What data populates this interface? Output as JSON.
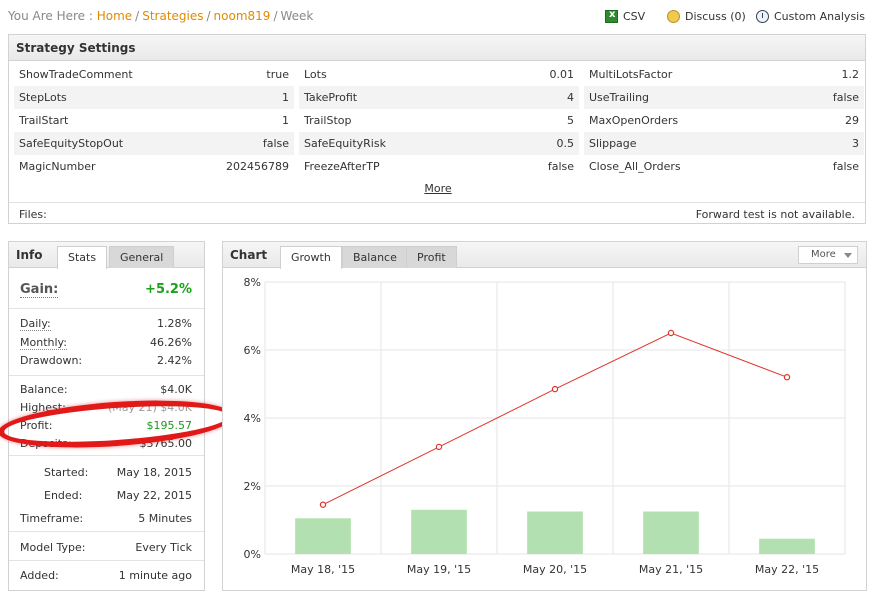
{
  "breadcrumb": {
    "prefix": "You Are Here :",
    "links": [
      "Home",
      "Strategies",
      "noom819"
    ],
    "current": "Week"
  },
  "actions": {
    "csv": "CSV",
    "discuss": "Discuss (0)",
    "custom_analysis": "Custom Analysis",
    "icons": [
      "excel-icon",
      "discuss-icon",
      "analysis-icon"
    ]
  },
  "settings": {
    "title": "Strategy Settings",
    "rows": [
      [
        [
          "ShowTradeComment",
          "true"
        ],
        [
          "Lots",
          "0.01"
        ],
        [
          "MultiLotsFactor",
          "1.2"
        ]
      ],
      [
        [
          "StepLots",
          "1"
        ],
        [
          "TakeProfit",
          "4"
        ],
        [
          "UseTrailing",
          "false"
        ]
      ],
      [
        [
          "TrailStart",
          "1"
        ],
        [
          "TrailStop",
          "5"
        ],
        [
          "MaxOpenOrders",
          "29"
        ]
      ],
      [
        [
          "SafeEquityStopOut",
          "false"
        ],
        [
          "SafeEquityRisk",
          "0.5"
        ],
        [
          "Slippage",
          "3"
        ]
      ],
      [
        [
          "MagicNumber",
          "202456789"
        ],
        [
          "FreezeAfterTP",
          "false"
        ],
        [
          "Close_All_Orders",
          "false"
        ]
      ]
    ],
    "more": "More",
    "files_label": "Files:",
    "forward_test": "Forward test is not available."
  },
  "info": {
    "title": "Info",
    "tabs": [
      "Stats",
      "General"
    ],
    "gain_label": "Gain:",
    "gain_value": "+5.2%",
    "daily_label": "Daily:",
    "daily_value": "1.28%",
    "monthly_label": "Monthly:",
    "monthly_value": "46.26%",
    "drawdown_label": "Drawdown:",
    "drawdown_value": "2.42%",
    "balance_label": "Balance:",
    "balance_value": "$4.0K",
    "highest_label": "Highest:",
    "highest_value": "(May 21) $4.0K",
    "profit_label": "Profit:",
    "profit_value": "$195.57",
    "deposits_label": "Deposits:",
    "deposits_value": "$3765.00",
    "started_label": "Started:",
    "started_value": "May 18, 2015",
    "ended_label": "Ended:",
    "ended_value": "May 22, 2015",
    "timeframe_label": "Timeframe:",
    "timeframe_value": "5 Minutes",
    "model_label": "Model Type:",
    "model_value": "Every Tick",
    "added_label": "Added:",
    "added_value": "1 minute ago"
  },
  "chart_panel": {
    "title": "Chart",
    "tabs": [
      "Growth",
      "Balance",
      "Profit"
    ],
    "more": "More"
  },
  "chart_data": {
    "type": "line",
    "categories": [
      "May 18, '15",
      "May 19, '15",
      "May 20, '15",
      "May 21, '15",
      "May 22, '15"
    ],
    "y_ticks": [
      "0%",
      "2%",
      "4%",
      "6%",
      "8%"
    ],
    "ylim": [
      0,
      8
    ],
    "grid": true,
    "colors": {
      "line": "#e0332d",
      "bars": "#b3e0b1",
      "grid": "#e6e6e6"
    },
    "series": [
      {
        "type": "line",
        "values": [
          1.45,
          3.15,
          4.85,
          6.5,
          5.2
        ]
      },
      {
        "type": "bar",
        "values": [
          1.05,
          1.3,
          1.25,
          1.25,
          0.45
        ]
      }
    ]
  }
}
